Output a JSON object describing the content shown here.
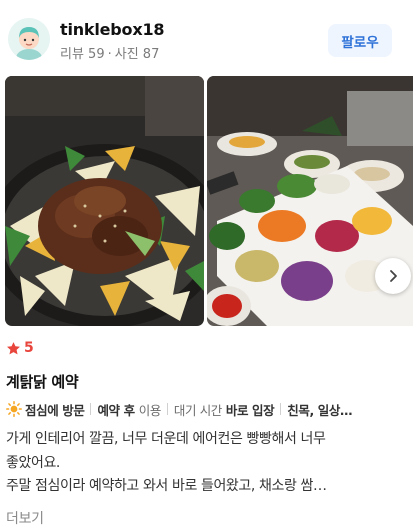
{
  "user": {
    "name": "tinklebox18",
    "reviews_label": "리뷰 59",
    "photos_label": "사진 87",
    "separator": "·"
  },
  "follow_button": {
    "label": "팔로우"
  },
  "photos": {
    "items": [
      {
        "icon": "grilled-chicken-photo"
      },
      {
        "icon": "vegetable-platter-photo"
      }
    ],
    "next_icon": "chevron-right-icon"
  },
  "rating": {
    "value": "5",
    "icon": "star-icon"
  },
  "menu_title": "계탉닭 예약",
  "tags": {
    "visit_time": "점심에 방문",
    "wait_strong": "예약 후",
    "wait_light": "이용",
    "wait_time_label": "대기 시간",
    "wait_time_value": "바로 입장",
    "companions": "친목, 일상…"
  },
  "review": {
    "lines": [
      "가게 인테리어 깔끔, 너무 더운데 에어컨은 빵빵해서 너무",
      "좋았어요.",
      "주말 점심이라 예약하고 와서 바로 들어왔고, 채소랑 쌈…"
    ],
    "more_label": "더보기"
  },
  "colors": {
    "accent": "#2f72d8",
    "star": "#e8453c",
    "sun": "#f5a623"
  }
}
